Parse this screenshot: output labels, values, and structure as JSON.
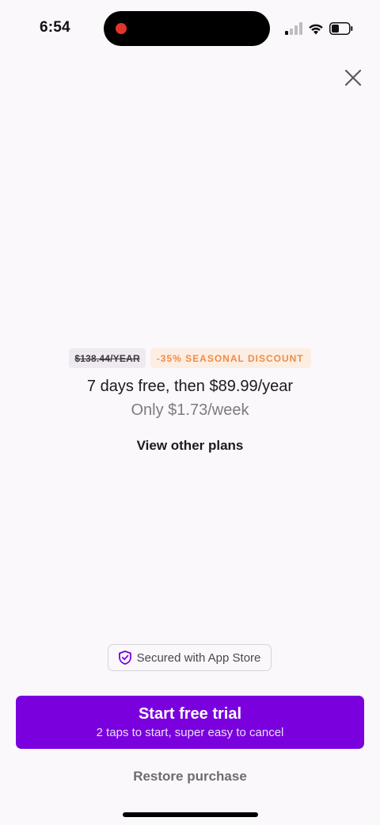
{
  "status_bar": {
    "time": "6:54",
    "icons": [
      "signal-icon",
      "wifi-icon",
      "battery-icon"
    ],
    "recording_color": "#e0352d"
  },
  "paywall": {
    "close_icon": "close-icon",
    "original_price": "$138.44/YEAR",
    "discount_label": "-35% SEASONAL DISCOUNT",
    "trial_text": "7 days free, then $89.99/year",
    "weekly_text": "Only $1.73/week",
    "other_plans_label": "View other plans",
    "secured_label": "Secured with App Store",
    "secured_icon": "shield-check-icon",
    "cta_title": "Start free trial",
    "cta_subtitle": "2 taps to start, super easy to cancel",
    "restore_label": "Restore purchase"
  },
  "colors": {
    "background": "#fbf8fc",
    "accent": "#7a00de",
    "discount": "#ef8c49"
  }
}
